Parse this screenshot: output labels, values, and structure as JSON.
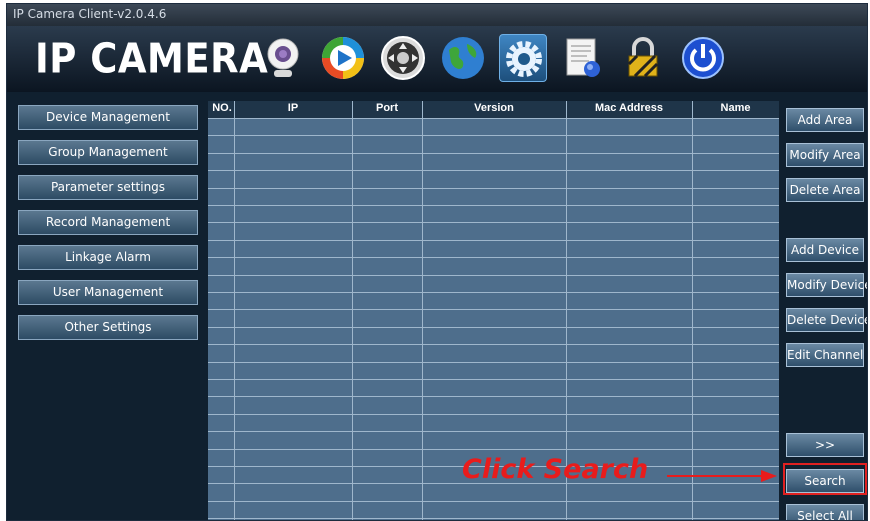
{
  "window": {
    "title": "IP Camera Client-v2.0.4.6"
  },
  "header": {
    "logo": "IP CAMERA",
    "tools": [
      {
        "icon": "webcam-icon"
      },
      {
        "icon": "play-icon"
      },
      {
        "icon": "ptz-icon"
      },
      {
        "icon": "globe-icon"
      },
      {
        "icon": "settings-gear-icon",
        "active": true
      },
      {
        "icon": "log-document-icon"
      },
      {
        "icon": "lock-icon"
      },
      {
        "icon": "power-icon"
      }
    ]
  },
  "sidebar": {
    "items": [
      {
        "label": "Device Management"
      },
      {
        "label": "Group Management"
      },
      {
        "label": "Parameter settings"
      },
      {
        "label": "Record Management"
      },
      {
        "label": "Linkage Alarm"
      },
      {
        "label": "User Management"
      },
      {
        "label": "Other Settings"
      }
    ]
  },
  "table": {
    "columns": [
      "NO.",
      "IP",
      "Port",
      "Version",
      "Mac Address",
      "Name"
    ],
    "rows": []
  },
  "actions": {
    "add_area": "Add Area",
    "modify_area": "Modify Area",
    "delete_area": "Delete Area",
    "add_device": "Add Device",
    "modify_device": "Modify Device",
    "delete_device": "Delete Device",
    "edit_channel": "Edit Channel",
    "more": ">>",
    "search": "Search",
    "select_all": "Select All"
  },
  "annotation": {
    "text": "Click Search",
    "color": "#e81c1c"
  },
  "colors": {
    "accent": "#3f86c3",
    "grid": "#4e6e8c",
    "background": "#10202f"
  }
}
